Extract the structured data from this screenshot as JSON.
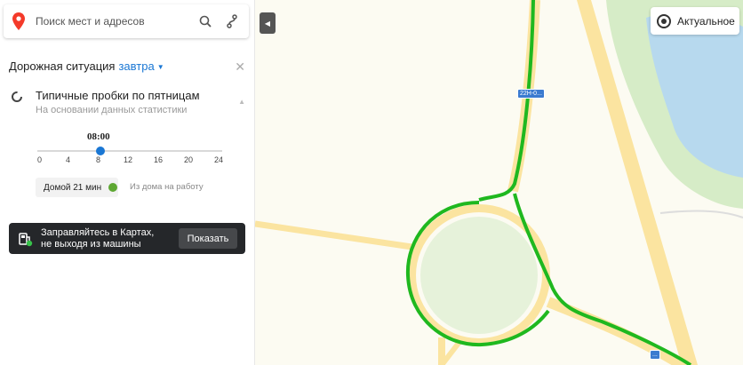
{
  "search": {
    "placeholder": "Поиск мест и адресов",
    "icons": [
      "map-pin-icon",
      "search-icon",
      "route-icon"
    ]
  },
  "traffic": {
    "title": "Дорожная ситуация",
    "day": "завтра",
    "mode_title": "Типичные пробки по пятницам",
    "mode_subtitle": "На основании данных статистики",
    "time": "08:00",
    "slider_value_hours": 8,
    "ticks": [
      "0",
      "4",
      "8",
      "12",
      "16",
      "20",
      "24"
    ],
    "route_home": "Домой 21 мин",
    "route_work": "Из дома на работу"
  },
  "promo": {
    "line1": "Заправляйтесь в Картах,",
    "line2": "не выходя из машины",
    "button": "Показать"
  },
  "map": {
    "layer_button": "Актуальное",
    "road_shield_1": "22Н-0...",
    "road_shield_2": "...",
    "colors": {
      "traffic_green": "#1fb81f",
      "road": "#fbe4a0",
      "water": "#b7d9ee",
      "park": "#d6ecc7",
      "accent": "#1a77d4"
    }
  }
}
